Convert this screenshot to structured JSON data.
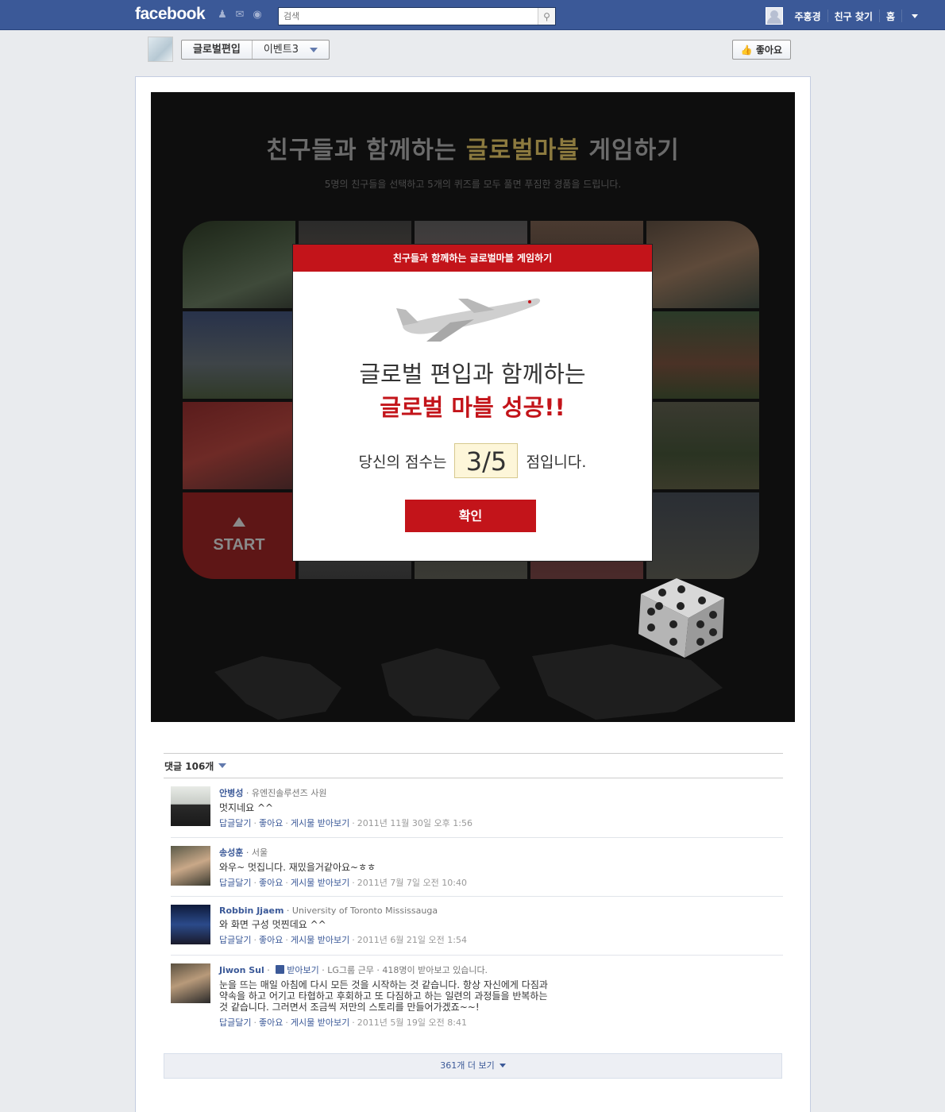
{
  "topbar": {
    "logo": "facebook",
    "search_placeholder": "검색",
    "user_name": "주홍경",
    "find_friends": "친구 찾기",
    "home": "홈"
  },
  "page_header": {
    "page_name": "글로벌편입",
    "tab_name": "이벤트3",
    "like_label": "좋아요"
  },
  "game": {
    "title_plain": "친구들과 함께하는 ",
    "title_highlight": "글로벌마블",
    "title_end": " 게임하기",
    "subtitle": "5명의 친구들을 선택하고 5개의 퀴즈를 모두 풀면 푸짐한 경품을 드립니다.",
    "start_label": "START"
  },
  "modal": {
    "header": "친구들과 함께하는 글로벌마블 게임하기",
    "line1": "글로벌 편입과 함께하는",
    "line2": "글로벌 마블 성공!!",
    "score_prefix": "당신의 점수는",
    "score": "3/5",
    "score_suffix": "점입니다.",
    "confirm": "확인"
  },
  "comments": {
    "header": "댓글 106개",
    "items": [
      {
        "name": "안병성",
        "meta": " · 유엔진솔루션즈 사원",
        "text": "멋지네요 ^^",
        "reply": "답글달기",
        "like": "좋아요",
        "follow": "게시물 받아보기",
        "time": "2011년 11월 30일 오후 1:56"
      },
      {
        "name": "송성훈",
        "meta": " · 서울",
        "text": "와우~ 멋집니다. 재밌을거같아요~ㅎㅎ",
        "reply": "답글달기",
        "like": "좋아요",
        "follow": "게시물 받아보기",
        "time": "2011년 7월 7일 오전 10:40"
      },
      {
        "name": "Robbin Jjaem",
        "meta": " · University of Toronto Mississauga",
        "text": "와 화면 구성 멋찐데요 ^^",
        "reply": "답글달기",
        "like": "좋아요",
        "follow": "게시물 받아보기",
        "time": "2011년 6월 21일 오전 1:54"
      },
      {
        "name": "Jiwon Sul",
        "subscribe": "받아보기",
        "meta": " · LG그룹 근무 · 418명이 받아보고 있습니다.",
        "text": "눈을 뜨는 매일 아침에 다시 모든 것을 시작하는 것 같습니다. 항상 자신에게 다짐과 약속을 하고 어기고 타협하고 후회하고 또 다짐하고 하는 일련의 과정들을 반복하는 것 같습니다. 그러면서 조금씩 저만의 스토리를 만들어가겠죠~~!",
        "reply": "답글달기",
        "like": "좋아요",
        "follow": "게시물 받아보기",
        "time": "2011년 5월 19일 오전 8:41"
      }
    ],
    "more": "361개 더 보기"
  },
  "colors": {
    "fb_blue": "#3b5998",
    "accent_red": "#c3141a"
  }
}
